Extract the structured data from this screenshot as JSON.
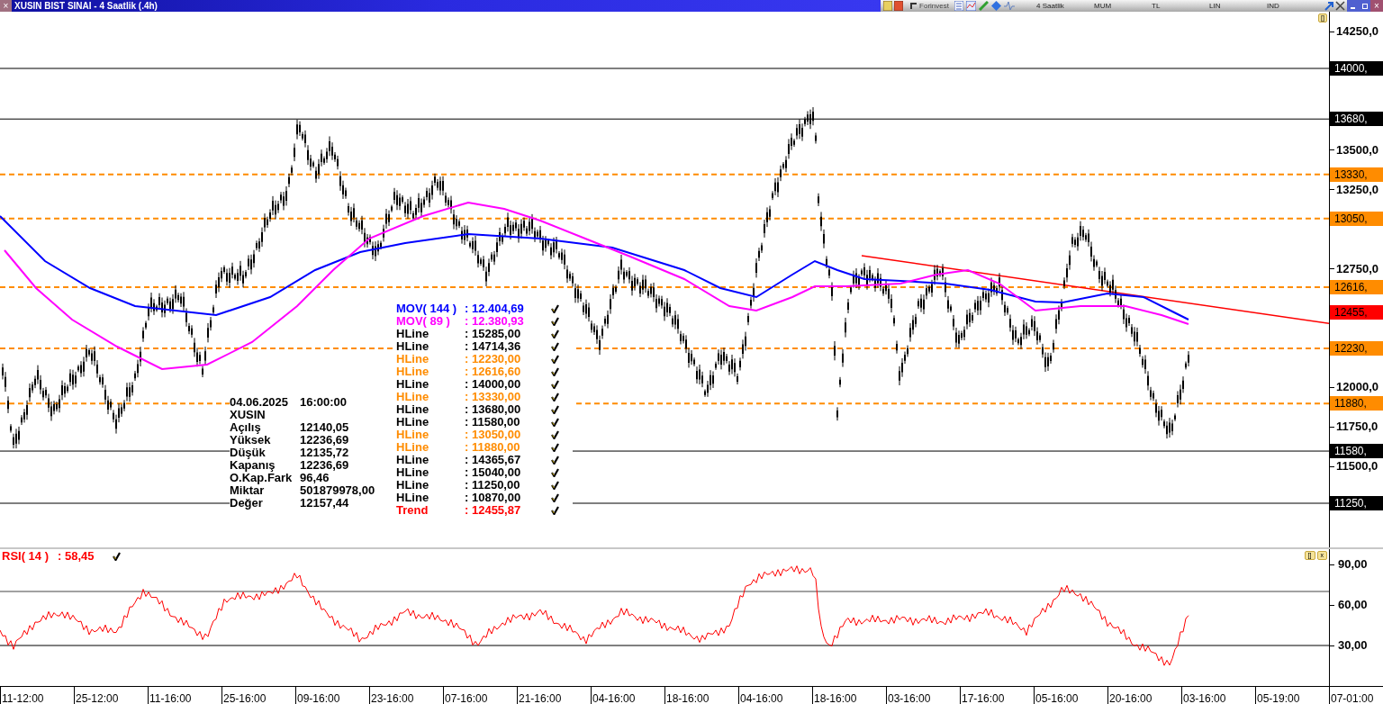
{
  "window": {
    "title": "XUSIN BIST SINAI - 4 Saatlik (.4h)",
    "close_glyph": "×"
  },
  "toolbar": {
    "logo": "Forinvest",
    "items": [
      "4 Saatlik",
      "MUM",
      "TL",
      "LIN",
      "IND"
    ]
  },
  "price_pane": {
    "pane_button": "[]",
    "axis_ticks": [
      "14250,0",
      "13500,0",
      "13250,0",
      "12750,0",
      "12000,0",
      "11750,0",
      "11500,0"
    ],
    "level_tags": [
      {
        "label": "14000,",
        "color": "#000000",
        "kind": "solid"
      },
      {
        "label": "13680,",
        "color": "#000000",
        "kind": "solid"
      },
      {
        "label": "13330,",
        "color": "#ff8c00",
        "kind": "dashed"
      },
      {
        "label": "13050,",
        "color": "#ff8c00",
        "kind": "dashed"
      },
      {
        "label": "12616,",
        "color": "#ff8c00",
        "kind": "dashed"
      },
      {
        "label": "12455,",
        "color": "#ff0000",
        "kind": "trend"
      },
      {
        "label": "12230,",
        "color": "#ff8c00",
        "kind": "dashed"
      },
      {
        "label": "11880,",
        "color": "#ff8c00",
        "kind": "dashed"
      },
      {
        "label": "11580,",
        "color": "#000000",
        "kind": "solid"
      },
      {
        "label": "11250,",
        "color": "#000000",
        "kind": "solid"
      }
    ],
    "info": {
      "date": "04.06.2025",
      "time": "16:00:00",
      "symbol": "XUSIN",
      "rows": [
        {
          "label": "Açılış",
          "value": "12140,05"
        },
        {
          "label": "Yüksek",
          "value": "12236,69"
        },
        {
          "label": "Düşük",
          "value": "12135,72"
        },
        {
          "label": "Kapanış",
          "value": "12236,69"
        },
        {
          "label": "O.Kap.Fark",
          "value": "96,46"
        },
        {
          "label": "Miktar",
          "value": "501879978,00"
        },
        {
          "label": "Değer",
          "value": "12157,44"
        }
      ]
    },
    "legend": [
      {
        "label": "MOV( 144 )",
        "value": ": 12.404,69",
        "color": "#0000ff"
      },
      {
        "label": "MOV( 89 )",
        "value": ": 12.380,93",
        "color": "#ff00ff"
      },
      {
        "label": "HLine",
        "value": ": 15285,00",
        "color": "#000000"
      },
      {
        "label": "HLine",
        "value": ": 14714,36",
        "color": "#000000"
      },
      {
        "label": "HLine",
        "value": ": 12230,00",
        "color": "#ff8c00"
      },
      {
        "label": "HLine",
        "value": ": 12616,60",
        "color": "#ff8c00"
      },
      {
        "label": "HLine",
        "value": ": 14000,00",
        "color": "#000000"
      },
      {
        "label": "HLine",
        "value": ": 13330,00",
        "color": "#ff8c00"
      },
      {
        "label": "HLine",
        "value": ": 13680,00",
        "color": "#000000"
      },
      {
        "label": "HLine",
        "value": ": 11580,00",
        "color": "#000000"
      },
      {
        "label": "HLine",
        "value": ": 13050,00",
        "color": "#ff8c00"
      },
      {
        "label": "HLine",
        "value": ": 11880,00",
        "color": "#ff8c00"
      },
      {
        "label": "HLine",
        "value": ": 14365,67",
        "color": "#000000"
      },
      {
        "label": "HLine",
        "value": ": 15040,00",
        "color": "#000000"
      },
      {
        "label": "HLine",
        "value": ": 11250,00",
        "color": "#000000"
      },
      {
        "label": "HLine",
        "value": ": 10870,00",
        "color": "#000000"
      },
      {
        "label": "Trend",
        "value": ": 12455,87",
        "color": "#ff0000"
      }
    ]
  },
  "rsi_pane": {
    "label": "RSI( 14 )",
    "value": ": 58,45",
    "pane_buttons": [
      "[]",
      "x"
    ],
    "axis_ticks": [
      "90,00",
      "60,00",
      "30,00"
    ]
  },
  "time_axis": [
    "11-12:00",
    "25-12:00",
    "11-16:00",
    "25-16:00",
    "09-16:00",
    "23-16:00",
    "07-16:00",
    "21-16:00",
    "04-16:00",
    "18-16:00",
    "04-16:00",
    "18-16:00",
    "03-16:00",
    "17-16:00",
    "05-16:00",
    "20-16:00",
    "03-16:00",
    "05-19:00",
    "07-01:00"
  ]
}
